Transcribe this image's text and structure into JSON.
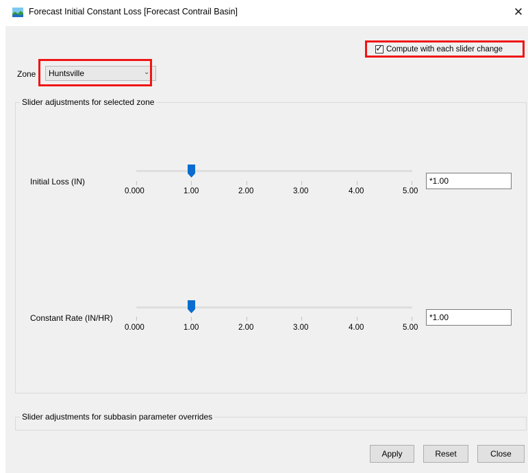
{
  "window": {
    "title": "Forecast Initial Constant Loss [Forecast Contrail Basin]",
    "close_glyph": "✕"
  },
  "compute": {
    "checked": true,
    "label": "Compute with each slider change"
  },
  "zone": {
    "label": "Zone",
    "selected": "Huntsville"
  },
  "groups": {
    "main_title": "Slider adjustments for selected zone",
    "sub_title": "Slider adjustments for subbasin parameter overrides"
  },
  "sliders": [
    {
      "label": "Initial Loss (IN)",
      "ticks": [
        "0.000",
        "1.00",
        "2.00",
        "3.00",
        "4.00",
        "5.00"
      ],
      "min": 0,
      "max": 5,
      "value": 1.0,
      "input_value": "*1.00"
    },
    {
      "label": "Constant Rate (IN/HR)",
      "ticks": [
        "0.000",
        "1.00",
        "2.00",
        "3.00",
        "4.00",
        "5.00"
      ],
      "min": 0,
      "max": 5,
      "value": 1.0,
      "input_value": "*1.00"
    }
  ],
  "buttons": {
    "apply": "Apply",
    "reset": "Reset",
    "close": "Close"
  },
  "colors": {
    "highlight": "#f01414",
    "slider_thumb": "#0a6ccf",
    "background": "#f0f0f0"
  },
  "icons": {
    "app": "hydrology-app-icon",
    "close": "close-icon",
    "dropdown": "chevron-down-icon",
    "check": "checkmark-icon"
  }
}
